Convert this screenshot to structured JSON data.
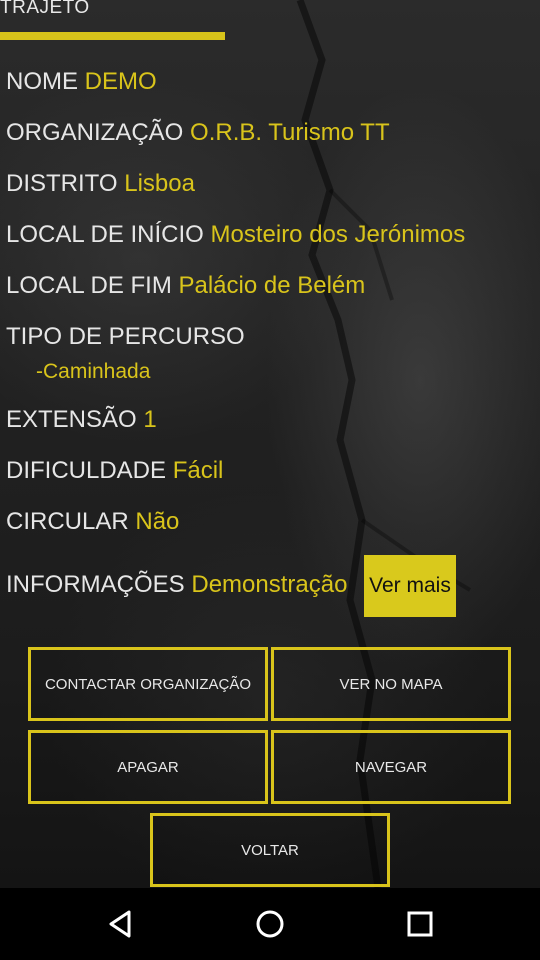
{
  "header": {
    "title": "TRAJETO"
  },
  "fields": {
    "nome": {
      "label": "NOME",
      "value": "DEMO"
    },
    "organizacao": {
      "label": "ORGANIZAÇÃO",
      "value": "O.R.B. Turismo TT"
    },
    "distrito": {
      "label": "DISTRITO",
      "value": "Lisboa"
    },
    "local_inicio": {
      "label": "LOCAL DE INÍCIO",
      "value": "Mosteiro dos Jerónimos"
    },
    "local_fim": {
      "label": "LOCAL DE FIM",
      "value": "Palácio de Belém"
    },
    "tipo_percurso": {
      "label": "TIPO DE PERCURSO",
      "value": "-Caminhada"
    },
    "extensao": {
      "label": "EXTENSÃO",
      "value": "1"
    },
    "dificuldade": {
      "label": "DIFICULDADE",
      "value": "Fácil"
    },
    "circular": {
      "label": "CIRCULAR",
      "value": "Não"
    },
    "informacoes": {
      "label": "INFORMAÇÕES",
      "value": "Demonstração",
      "more_label": "Ver mais"
    }
  },
  "buttons": {
    "contactar": "CONTACTAR ORGANIZAÇÃO",
    "ver_mapa": "VER NO MAPA",
    "apagar": "APAGAR",
    "navegar": "NAVEGAR",
    "voltar": "VOLTAR"
  },
  "navbar": {
    "back_icon": "triangle-back-icon",
    "home_icon": "circle-home-icon",
    "recents_icon": "square-recents-icon"
  },
  "colors": {
    "accent": "#d9c41b",
    "text": "#e6e6e6",
    "navbar": "#000000"
  }
}
